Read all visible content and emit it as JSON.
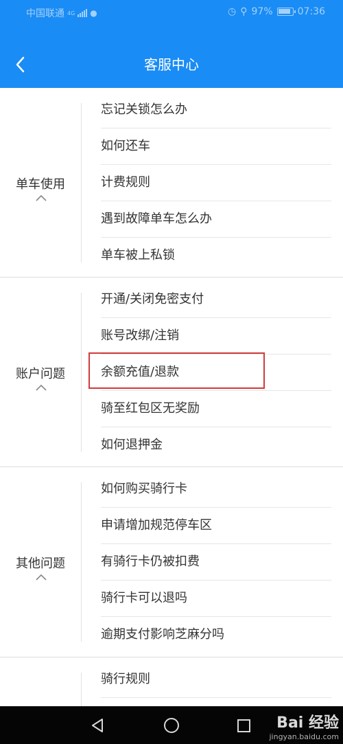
{
  "status_bar": {
    "carrier": "中国联通",
    "network": "4G",
    "battery": "97%",
    "time": "07:36"
  },
  "header": {
    "title": "客服中心"
  },
  "sections": [
    {
      "category": "单车使用",
      "items": [
        "忘记关锁怎么办",
        "如何还车",
        "计费规则",
        "遇到故障单车怎么办",
        "单车被上私锁"
      ]
    },
    {
      "category": "账户问题",
      "items": [
        "开通/关闭免密支付",
        "账号改绑/注销",
        "余额充值/退款",
        "骑至红包区无奖励",
        "如何退押金"
      ]
    },
    {
      "category": "其他问题",
      "items": [
        "如何购买骑行卡",
        "申请增加规范停车区",
        "有骑行卡仍被扣费",
        "骑行卡可以退吗",
        "逾期支付影响芝麻分吗"
      ]
    },
    {
      "category": "",
      "items": [
        "骑行规则"
      ]
    }
  ],
  "watermark": {
    "logo": "Bai 经验",
    "url": "jingyan.baidu.com"
  },
  "colors": {
    "header_bg": "#1a8cf5",
    "highlight_border": "#d2393a"
  }
}
